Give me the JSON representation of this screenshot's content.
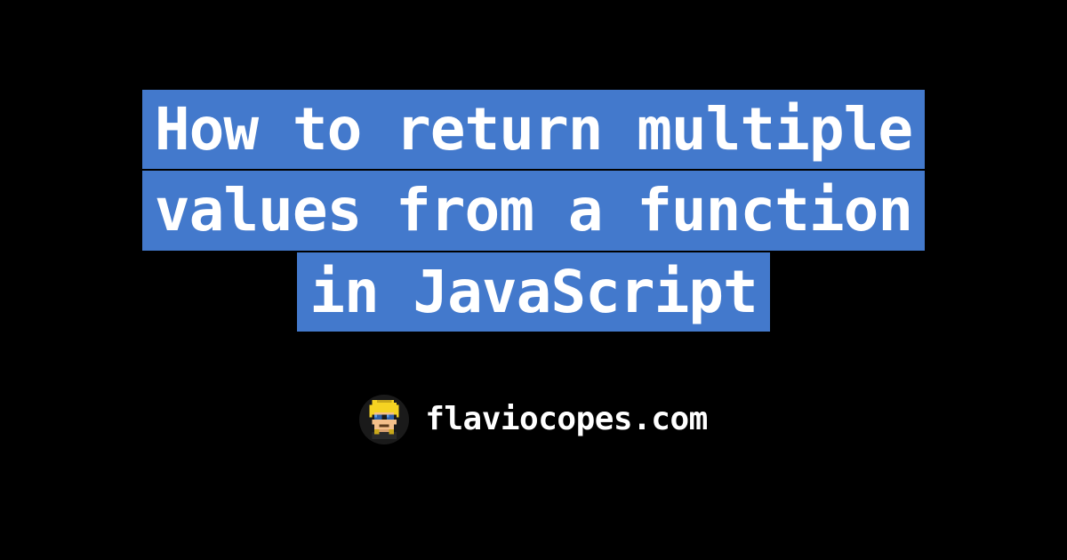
{
  "title": {
    "line1": "How to return multiple",
    "line2": "values from a function",
    "line3": "in JavaScript"
  },
  "footer": {
    "site": "flaviocopes.com"
  },
  "colors": {
    "background": "#000000",
    "highlight": "#4379cc",
    "text": "#ffffff"
  }
}
